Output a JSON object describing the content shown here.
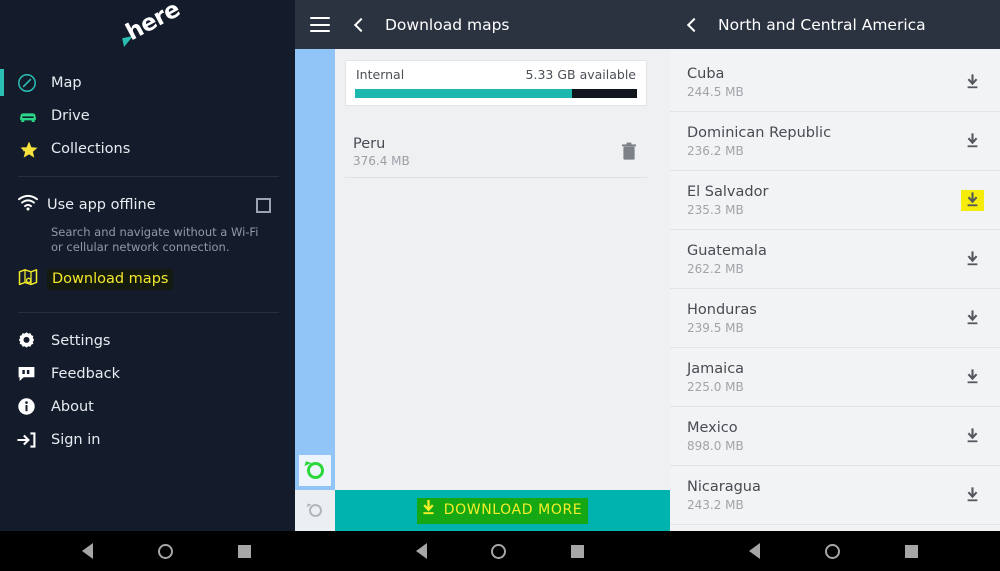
{
  "sidebar": {
    "logo": {
      "word": "here",
      "icon": "here-logo"
    },
    "primary_items": [
      {
        "label": "Map",
        "icon": "compass-icon",
        "active": true
      },
      {
        "label": "Drive",
        "icon": "car-icon",
        "active": false
      },
      {
        "label": "Collections",
        "icon": "star-icon",
        "active": false
      }
    ],
    "offline": {
      "label": "Use app offline",
      "icon": "wifi-icon",
      "checked": false,
      "description": "Search and navigate without a Wi-Fi or cellular network connection."
    },
    "download_maps": {
      "label": "Download maps",
      "icon": "map-download-icon",
      "highlighted": true
    },
    "secondary_items": [
      {
        "label": "Settings",
        "icon": "gear-icon"
      },
      {
        "label": "Feedback",
        "icon": "feedback-icon"
      },
      {
        "label": "About",
        "icon": "info-icon"
      },
      {
        "label": "Sign in",
        "icon": "sign-in-icon"
      }
    ]
  },
  "middle": {
    "header": {
      "title": "Download maps",
      "menu_icon": "hamburger-icon",
      "back_icon": "chevron-left-icon"
    },
    "storage": {
      "label": "Internal",
      "available": "5.33 GB available",
      "used_percent": 77
    },
    "downloaded": [
      {
        "name": "Peru",
        "size": "376.4 MB",
        "action_icon": "trash-icon"
      }
    ],
    "map_controls": [
      {
        "icon": "gps-locked-icon",
        "selected": true
      },
      {
        "icon": "gps-idle-icon",
        "selected": false
      }
    ],
    "download_more_button": {
      "label": "DOWNLOAD MORE",
      "icon": "download-icon",
      "highlighted": true
    }
  },
  "right": {
    "header": {
      "title": "North and Central America",
      "back_icon": "chevron-left-icon"
    },
    "countries": [
      {
        "name": "Cuba",
        "size": "244.5 MB",
        "icon": "download-icon",
        "highlighted": false
      },
      {
        "name": "Dominican Republic",
        "size": "236.2 MB",
        "icon": "download-icon",
        "highlighted": false
      },
      {
        "name": "El Salvador",
        "size": "235.3 MB",
        "icon": "download-icon",
        "highlighted": true
      },
      {
        "name": "Guatemala",
        "size": "262.2 MB",
        "icon": "download-icon",
        "highlighted": false
      },
      {
        "name": "Honduras",
        "size": "239.5 MB",
        "icon": "download-icon",
        "highlighted": false
      },
      {
        "name": "Jamaica",
        "size": "225.0 MB",
        "icon": "download-icon",
        "highlighted": false
      },
      {
        "name": "Mexico",
        "size": "898.0 MB",
        "icon": "download-icon",
        "highlighted": false
      },
      {
        "name": "Nicaragua",
        "size": "243.2 MB",
        "icon": "download-icon",
        "highlighted": false
      }
    ]
  },
  "navbar": {
    "groups": [
      {
        "back_icon": "nav-back-icon",
        "home_icon": "nav-home-icon",
        "recents_icon": "nav-recents-icon"
      },
      {
        "back_icon": "nav-back-icon",
        "home_icon": "nav-home-icon",
        "recents_icon": "nav-recents-icon"
      },
      {
        "back_icon": "nav-back-icon",
        "home_icon": "nav-home-icon",
        "recents_icon": "nav-recents-icon"
      }
    ]
  },
  "colors": {
    "sidebar_bg": "#141c2b",
    "header_bg": "#2b3240",
    "accent_teal": "#1cb8b0",
    "highlight_yellow": "#f5ec0b",
    "highlight_green": "#15a814",
    "strip_blue": "#92c5f7"
  }
}
